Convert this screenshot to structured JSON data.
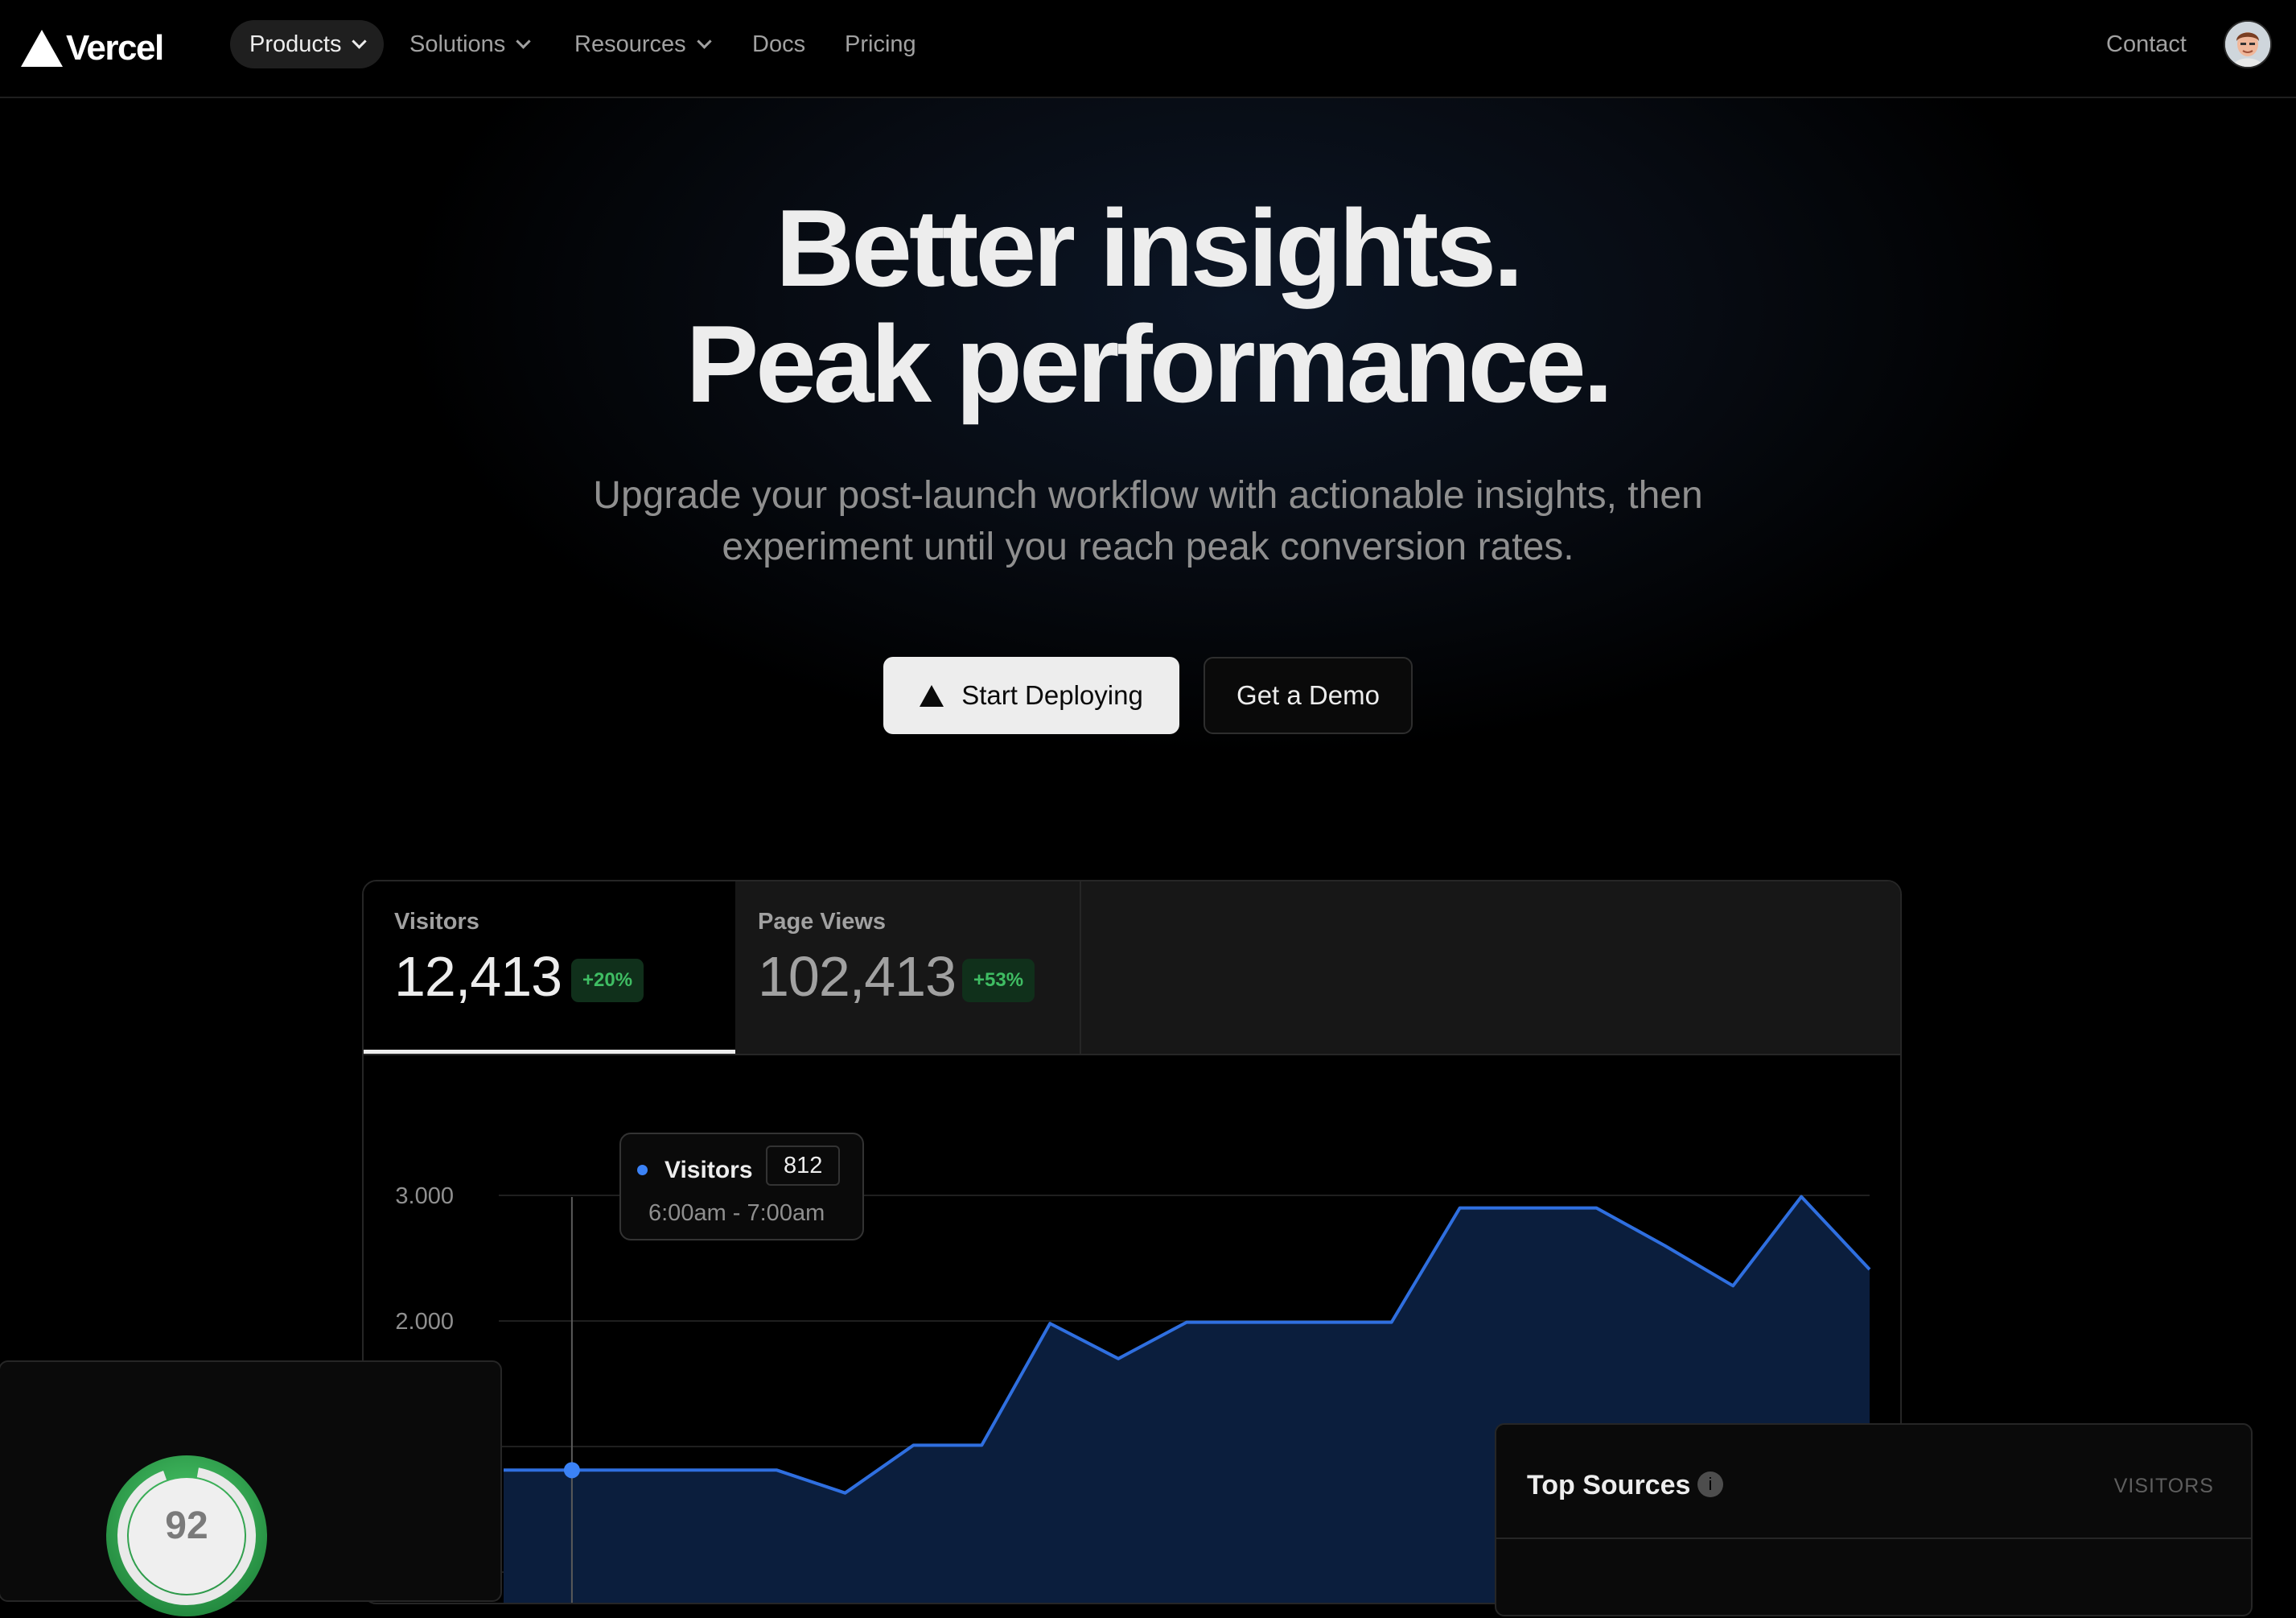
{
  "nav": {
    "brand": "Vercel",
    "items": [
      "Products",
      "Solutions",
      "Resources",
      "Docs",
      "Pricing"
    ],
    "contact": "Contact",
    "avatar_icon": "user-avatar-icon"
  },
  "hero": {
    "title_line1": "Better insights.",
    "title_line2": "Peak performance.",
    "subtitle_line1": "Upgrade your post-launch workflow with actionable insights, then",
    "subtitle_line2": "experiment until you reach peak conversion rates.",
    "primary_cta": "Start Deploying",
    "secondary_cta": "Get a Demo"
  },
  "dashboard": {
    "tabs": [
      {
        "label": "Visitors",
        "value": "12,413",
        "change": "+20%"
      },
      {
        "label": "Page Views",
        "value": "102,413",
        "change": "+53%"
      }
    ],
    "tooltip": {
      "series": "Visitors",
      "value": "812",
      "time": "6:00am - 7:00am"
    },
    "colors": {
      "line": "#2f6fe0",
      "fill": "#0b1e3d",
      "badge": "#3fbd63"
    }
  },
  "chart_data": {
    "type": "area",
    "y_ticks": [
      "3.000",
      "2.000"
    ],
    "ylim": [
      0,
      3000
    ],
    "series": [
      {
        "name": "Visitors",
        "values": [
          812,
          812,
          812,
          812,
          812,
          630,
          1010,
          1010,
          1980,
          1700,
          1990,
          1990,
          1990,
          1990,
          2900,
          2900,
          2900,
          2600,
          2280,
          2990,
          2410
        ]
      }
    ],
    "highlight_index": 1
  },
  "score_card": {
    "score": "92"
  },
  "top_sources": {
    "title": "Top Sources",
    "column": "VISITORS"
  }
}
